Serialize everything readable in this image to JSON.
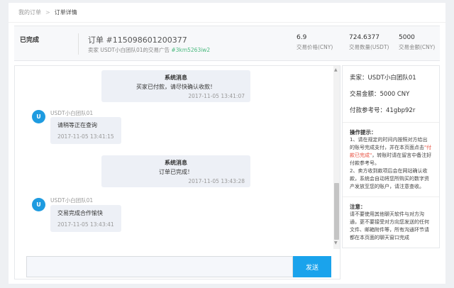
{
  "breadcrumb": {
    "root": "我的订单",
    "separator": ">",
    "current": "订单详情"
  },
  "order": {
    "status": "已完成",
    "number": "订单 #115098601200377",
    "sub_prefix": "卖家 USDT小白团队01的交易广告 ",
    "sub_ad": "#3km5263iw2",
    "stats": [
      {
        "value": "6.9",
        "label": "交易价格(CNY)"
      },
      {
        "value": "724.6377",
        "label": "交易数量(USDT)"
      },
      {
        "value": "5000",
        "label": "交易金额(CNY)"
      }
    ]
  },
  "chat": {
    "messages": [
      {
        "type": "system",
        "title": "系统消息",
        "text": "买家已付款，请尽快确认收款！",
        "time": "2017-11-05 13:41:07"
      },
      {
        "type": "user",
        "avatar": "U",
        "user": "USDT小白团队01",
        "text": "请稍等正在查询",
        "time": "2017-11-05 13:41:15"
      },
      {
        "type": "system",
        "title": "系统消息",
        "text": "订单已完成！",
        "time": "2017-11-05 13:43:28"
      },
      {
        "type": "user",
        "avatar": "U",
        "user": "USDT小白团队01",
        "text": "交易完成合作愉快",
        "time": "2017-11-05 13:43:41"
      }
    ],
    "input_value": "",
    "send_label": "发送",
    "scroll_up": "▲",
    "scroll_down": "▼"
  },
  "info": {
    "seller": "卖家：USDT小白团队01",
    "amount": "交易金额：5000 CNY",
    "ref": "付款参考号：41gbp92r",
    "tips_title": "操作提示：",
    "tip1_a": "1、请在规定的时间内按照对方给出的账号完成支付，并在本页面点击",
    "tip1_red": "\"付款已完成\"",
    "tip1_b": "，转账时请在留言中备注好付款参考号。",
    "tip2": "2、卖方收到款项后会在网站确认收款，系统会自动将您所购买的数字资产发放至您的账户，请注意查收。",
    "note_title": "注意：",
    "note": "请不要使用其他聊天软件与对方沟通，更不要接受对方向您发送的任何文件、邮箱附件等，所有沟通环节请都在本页面的聊天窗口完成"
  },
  "colors": {
    "accent": "#1aa3ec",
    "avatar": "#1e9be0",
    "ad_link": "#49b87d",
    "warning": "#e74c3c"
  }
}
